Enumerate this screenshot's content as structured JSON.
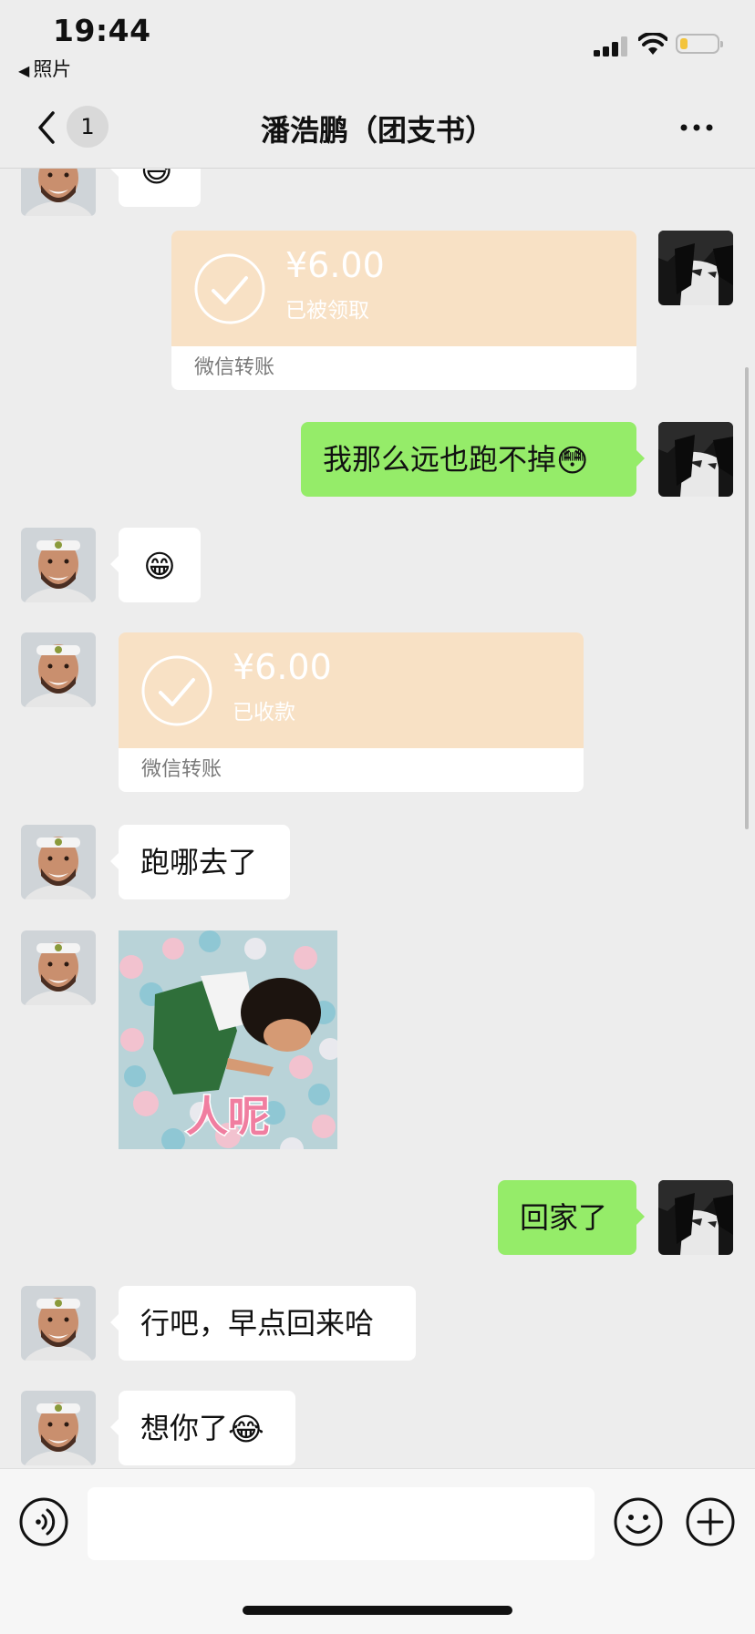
{
  "status_bar": {
    "time": "19:44",
    "back_app_label": "照片",
    "battery_level": 0.2,
    "accent": "#f3c43b"
  },
  "nav": {
    "unread_badge": "1",
    "title": "潘浩鹏（团支书）"
  },
  "messages": {
    "transfer1": {
      "amount": "¥6.00",
      "status": "已被领取",
      "label": "微信转账",
      "from": "me"
    },
    "msg_me_1": {
      "text": "我那么远也跑不掉",
      "emoji": "😳",
      "from": "me"
    },
    "msg_in_emoji": {
      "emoji": "😁",
      "from": "other"
    },
    "transfer2": {
      "amount": "¥6.00",
      "status": "已收款",
      "label": "微信转账",
      "from": "other"
    },
    "msg_in_1": {
      "text": "跑哪去了",
      "from": "other"
    },
    "sticker": {
      "caption": "人呢",
      "from": "other"
    },
    "msg_me_2": {
      "text": "回家了",
      "from": "me"
    },
    "msg_in_2": {
      "text": "行吧，早点回来哈",
      "from": "other"
    },
    "msg_in_3": {
      "text": "想你了",
      "emoji": "😂",
      "from": "other"
    }
  },
  "colors": {
    "outgoing_bubble": "#95ec69",
    "incoming_bubble": "#ffffff",
    "transfer_card": "#f8e1c5",
    "chat_background": "#ededed"
  },
  "icons": {
    "voice": "voice-icon",
    "emoji": "smiley-icon",
    "plus": "plus-icon",
    "back": "chevron-left-icon",
    "more": "more-icon"
  }
}
